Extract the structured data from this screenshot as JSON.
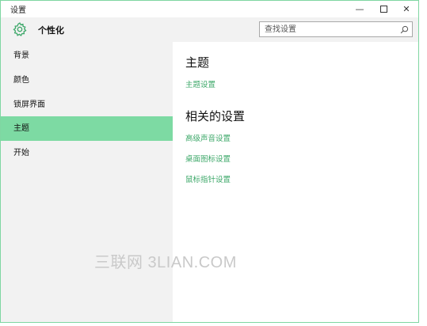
{
  "window": {
    "title": "设置"
  },
  "header": {
    "app_title": "个性化",
    "search_placeholder": "查找设置"
  },
  "sidebar": {
    "items": [
      {
        "label": "背景"
      },
      {
        "label": "颜色"
      },
      {
        "label": "锁屏界面"
      },
      {
        "label": "主题",
        "selected": true
      },
      {
        "label": "开始"
      }
    ]
  },
  "main": {
    "section_title": "主题",
    "theme_settings_link": "主题设置",
    "related_title": "相关的设置",
    "related_links": [
      "高级声音设置",
      "桌面图标设置",
      "鼠标指针设置"
    ]
  },
  "watermark": "三联网 3LIAN.COM",
  "colors": {
    "accent": "#3ea86a",
    "selection": "#7ddaa3",
    "window_border": "#7fd6a2"
  }
}
